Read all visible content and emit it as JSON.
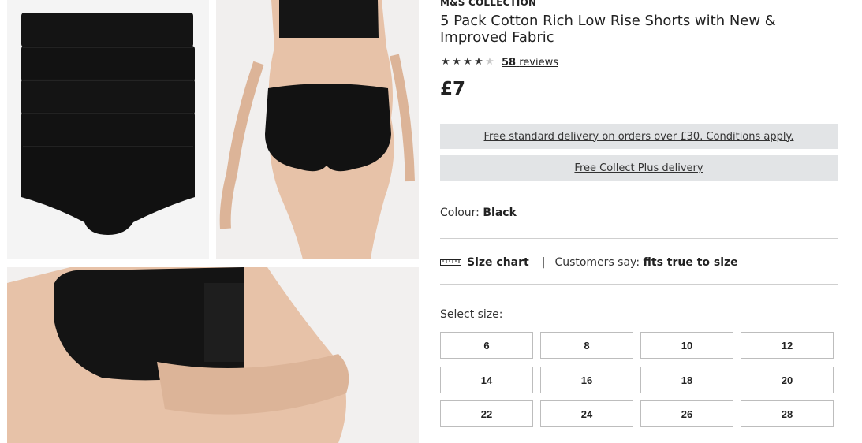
{
  "product": {
    "brand": "M&S COLLECTION",
    "title": "5 Pack Cotton Rich Low Rise Shorts with New & Improved Fabric",
    "rating": 4,
    "rating_max": 5,
    "reviews_count": "58",
    "reviews_label": "reviews",
    "price": "£7"
  },
  "delivery": [
    {
      "label": "Free standard delivery on orders over £30. Conditions apply."
    },
    {
      "label": "Free Collect Plus delivery"
    }
  ],
  "colour": {
    "label": "Colour:",
    "value": "Black"
  },
  "fit": {
    "size_chart_label": "Size chart",
    "separator": "|",
    "customers_say_label": "Customers say:",
    "customers_say_value": "fits true to size"
  },
  "sizes": {
    "label": "Select size:",
    "options": [
      "6",
      "8",
      "10",
      "12",
      "14",
      "16",
      "18",
      "20",
      "22",
      "24",
      "26",
      "28"
    ]
  },
  "gallery": [
    {
      "icon": "product-folded-shorts-image"
    },
    {
      "icon": "product-model-back-image"
    },
    {
      "icon": "product-model-side-image"
    }
  ],
  "colors": {
    "delivery_bg": "#e2e4e6",
    "garment": "#111111",
    "skin": "#e7c2a8"
  }
}
